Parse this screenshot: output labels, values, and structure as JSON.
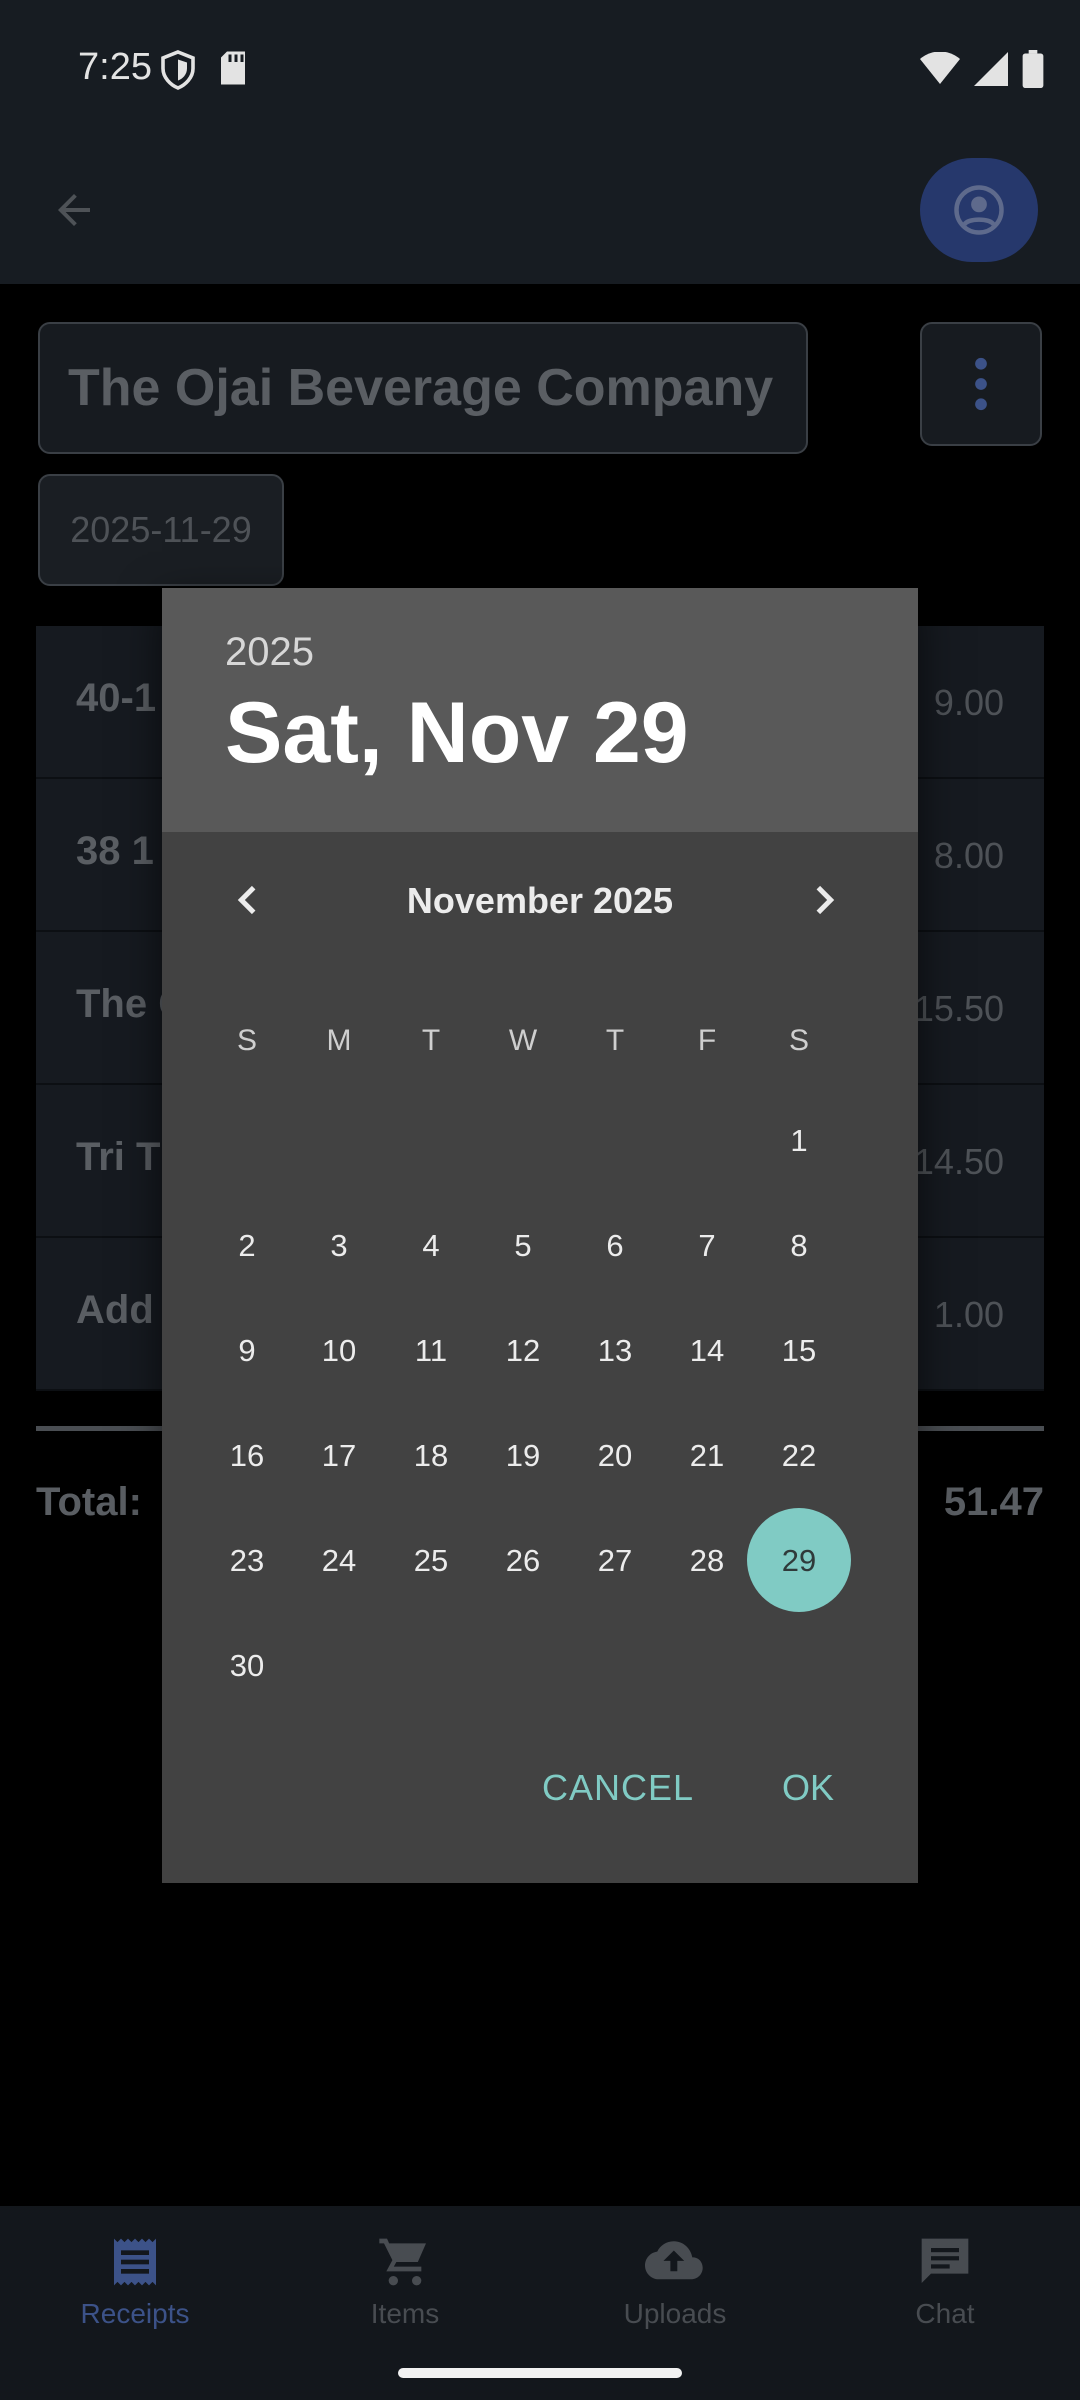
{
  "status_bar": {
    "time": "7:25"
  },
  "merchant": {
    "name": "The Ojai Beverage Company"
  },
  "receipt_date": "2025-11-29",
  "items": [
    {
      "name": "40-1",
      "price": "9.00"
    },
    {
      "name": "38 1",
      "price": "8.00"
    },
    {
      "name": "The C",
      "price": "15.50"
    },
    {
      "name": "Tri T",
      "price": "14.50"
    },
    {
      "name": "Add",
      "price": "1.00"
    }
  ],
  "total": {
    "label": "Total:",
    "value": "51.47"
  },
  "bottom_nav": [
    {
      "label": "Receipts",
      "icon": "receipt-icon",
      "active": true
    },
    {
      "label": "Items",
      "icon": "cart-icon",
      "active": false
    },
    {
      "label": "Uploads",
      "icon": "cloud-upload-icon",
      "active": false
    },
    {
      "label": "Chat",
      "icon": "chat-icon",
      "active": false
    }
  ],
  "date_picker": {
    "year": "2025",
    "selected_date": "Sat, Nov 29",
    "month_label": "November 2025",
    "weekdays": [
      "S",
      "M",
      "T",
      "W",
      "T",
      "F",
      "S"
    ],
    "leading_blanks": 6,
    "days": [
      "1",
      "2",
      "3",
      "4",
      "5",
      "6",
      "7",
      "8",
      "9",
      "10",
      "11",
      "12",
      "13",
      "14",
      "15",
      "16",
      "17",
      "18",
      "19",
      "20",
      "21",
      "22",
      "23",
      "24",
      "25",
      "26",
      "27",
      "28",
      "29",
      "30"
    ],
    "selected_day": "29",
    "cancel_label": "CANCEL",
    "ok_label": "OK"
  },
  "colors": {
    "accent": "#80cbc4",
    "dialog_bg": "#424242",
    "dialog_header_bg": "#595959",
    "active_nav": "#3c5288"
  }
}
